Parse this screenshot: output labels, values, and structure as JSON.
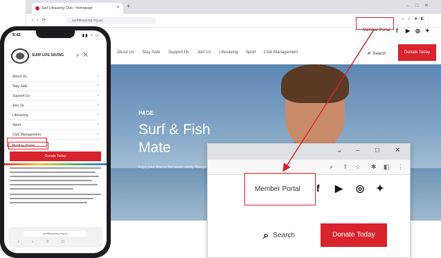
{
  "desktop": {
    "tab_title": "Surf Lifesaving Club - Homepage",
    "url": "surflifesaving.org.au",
    "topbar": {
      "member_portal": "Member Portal"
    },
    "nav": [
      "About Us",
      "Stay Safe",
      "Support Us",
      "Join Us",
      "Lifesaving",
      "Sport",
      "Club Management"
    ],
    "search_label": "Search",
    "donate_label": "Donate Today",
    "hero": {
      "kicker": "PAGE",
      "title_line1": "Surf & Fish",
      "title_line2": "Mate",
      "subtitle": "Enjoy your time on the beach safely. Always Swim Together."
    }
  },
  "phone": {
    "time": "9:41",
    "logo_text": "SURF LIFE SAVING",
    "menu": [
      "About Us",
      "Stay Safe",
      "Support Us",
      "Join Us",
      "Lifesaving",
      "Sport",
      "Club Management"
    ],
    "member_portal": "Member Portal",
    "donate_label": "Donate Today",
    "url": "surflifesaving.org.au"
  },
  "zoom": {
    "member_portal": "Member Portal",
    "search_label": "Search",
    "donate_label": "Donate Today"
  },
  "colors": {
    "accent": "#d9232d",
    "annotation": "#d9232d"
  },
  "icons": {
    "social": [
      "facebook-icon",
      "youtube-icon",
      "instagram-icon",
      "twitter-icon"
    ],
    "search": "search-icon"
  }
}
